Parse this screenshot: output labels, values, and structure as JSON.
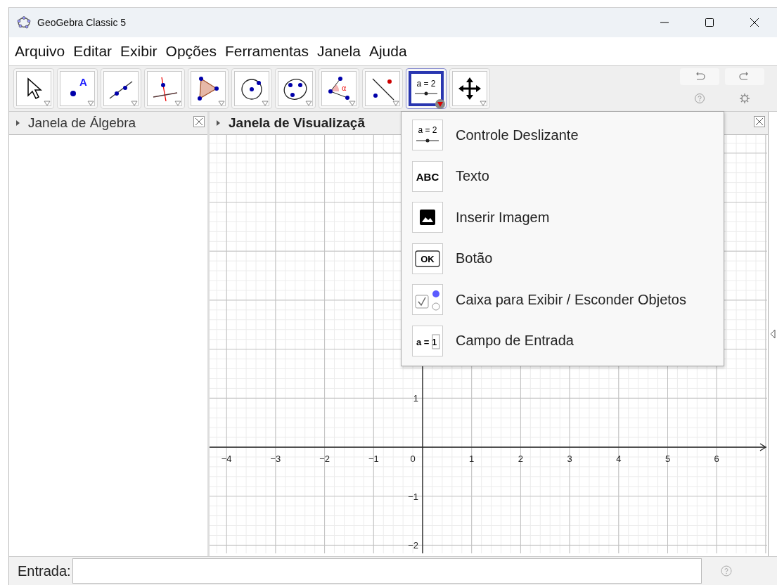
{
  "window": {
    "title": "GeoGebra Classic 5"
  },
  "menu": [
    "Arquivo",
    "Editar",
    "Exibir",
    "Opções",
    "Ferramentas",
    "Janela",
    "Ajuda"
  ],
  "tools": [
    {
      "kind": "move",
      "selected": false
    },
    {
      "kind": "point",
      "icon_text": "A",
      "selected": false
    },
    {
      "kind": "line",
      "selected": false
    },
    {
      "kind": "perpendicular",
      "selected": false
    },
    {
      "kind": "polygon",
      "selected": false
    },
    {
      "kind": "circle",
      "selected": false
    },
    {
      "kind": "conic",
      "selected": false
    },
    {
      "kind": "angle",
      "icon_text": "α",
      "selected": false
    },
    {
      "kind": "reflect",
      "selected": false
    },
    {
      "kind": "slider",
      "icon_text": "a = 2",
      "selected": true
    },
    {
      "kind": "move_view",
      "selected": false
    }
  ],
  "algebra_panel": {
    "title": "Janela de Álgebra"
  },
  "graphics_panel": {
    "title": "Janela de Visualizaçã",
    "x_labels": [
      "−4",
      "−3",
      "−2",
      "−1",
      "0",
      "1",
      "2",
      "3",
      "4",
      "5",
      "6"
    ],
    "y_labels": [
      "1",
      "−1",
      "−2"
    ]
  },
  "tool_menu": [
    {
      "kind": "slider",
      "icon_text": "a = 2",
      "label": "Controle Deslizante"
    },
    {
      "kind": "text",
      "icon_text": "ABC",
      "label": "Texto"
    },
    {
      "kind": "image",
      "label": "Inserir Imagem"
    },
    {
      "kind": "button",
      "icon_text": "OK",
      "label": "Botão"
    },
    {
      "kind": "checkbox",
      "label": "Caixa para Exibir / Esconder Objetos"
    },
    {
      "kind": "input",
      "icon_text": "a = 1",
      "label": "Campo de Entrada"
    }
  ],
  "input_bar": {
    "label": "Entrada:"
  }
}
